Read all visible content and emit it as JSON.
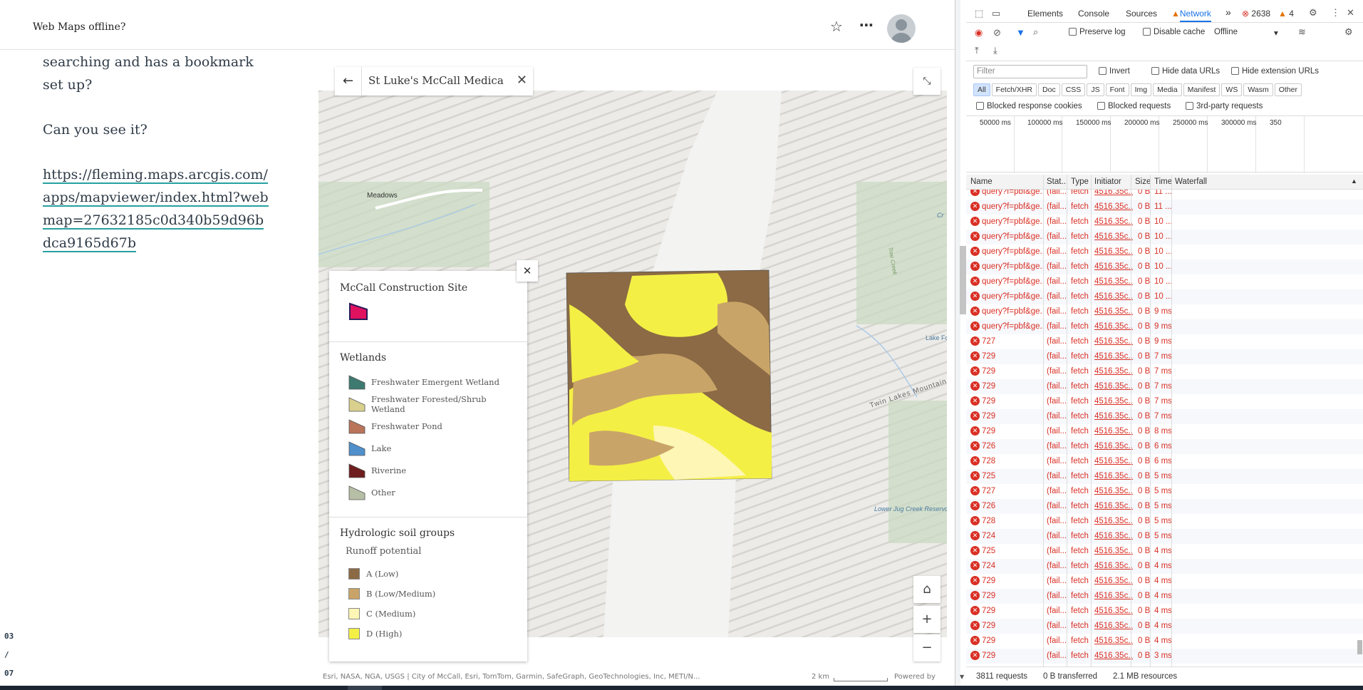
{
  "header": {
    "title": "Web Maps offline?"
  },
  "story": {
    "p1": "This map allows navigation, searching and has a bookmark set up?",
    "p2": "Can you see it?",
    "link": "https://fleming.maps.arcgis.com/apps/mapviewer/index.html?webmap=27632185c0d340b59d96bdca9165d67b"
  },
  "pager": {
    "current": "03",
    "sep": "/",
    "total": "07"
  },
  "map": {
    "search_value": "St Luke's McCall Medical",
    "attribution": "Esri, NASA, NGA, USGS | City of McCall, Esri, TomTom, Garmin, SafeGraph, GeoTechnologies, Inc, METI/N...",
    "scale": "2 km",
    "powered": "Powered by Esri",
    "labels": {
      "meadows": "Meadows",
      "lake_fork": "Lake Fork",
      "twin_lakes": "Twin Lakes Mountain",
      "lower_jug": "Lower Jug Creek Reservoir",
      "tree_creek": "Tree Creek",
      "cr": "Cr"
    }
  },
  "legend": {
    "site_title": "McCall Construction Site",
    "wetlands_title": "Wetlands",
    "wetlands": [
      {
        "label": "Freshwater Emergent Wetland",
        "color": "#3d7a70"
      },
      {
        "label": "Freshwater Forested/Shrub Wetland",
        "color": "#d9d08e"
      },
      {
        "label": "Freshwater Pond",
        "color": "#b9745a"
      },
      {
        "label": "Lake",
        "color": "#4f8fcc"
      },
      {
        "label": "Riverine",
        "color": "#6e1e1e"
      },
      {
        "label": "Other",
        "color": "#b6bea5"
      }
    ],
    "soil_title": "Hydrologic soil groups",
    "soil_sub": "Runoff potential",
    "soils": [
      {
        "label": "A (Low)",
        "color": "#8b6a45"
      },
      {
        "label": "B (Low/Medium)",
        "color": "#c9a468"
      },
      {
        "label": "C (Medium)",
        "color": "#fdf6b4"
      },
      {
        "label": "D (High)",
        "color": "#f4ef45"
      }
    ]
  },
  "devtools": {
    "tabs": [
      "Elements",
      "Console",
      "Sources",
      "Network"
    ],
    "errors": "2638",
    "warnings": "4",
    "preserve_log": "Preserve log",
    "disable_cache": "Disable cache",
    "throttle": "Offline",
    "filter_placeholder": "Filter",
    "invert": "Invert",
    "hide_data": "Hide data URLs",
    "hide_ext": "Hide extension URLs",
    "types": [
      "All",
      "Fetch/XHR",
      "Doc",
      "CSS",
      "JS",
      "Font",
      "Img",
      "Media",
      "Manifest",
      "WS",
      "Wasm",
      "Other"
    ],
    "blocked_cookies": "Blocked response cookies",
    "blocked_requests": "Blocked requests",
    "third_party": "3rd-party requests",
    "timeline": [
      "50000 ms",
      "100000 ms",
      "150000 ms",
      "200000 ms",
      "250000 ms",
      "300000 ms",
      "350"
    ],
    "columns": [
      "Name",
      "Stat...",
      "Type",
      "Initiator",
      "Size",
      "Time",
      "Waterfall"
    ],
    "rows": [
      {
        "name": "query?f=pbf&ge...",
        "status": "(fail...",
        "type": "fetch",
        "initiator": "4516.35c...",
        "size": "0 B",
        "time": "11 ..."
      },
      {
        "name": "query?f=pbf&ge...",
        "status": "(fail...",
        "type": "fetch",
        "initiator": "4516.35c...",
        "size": "0 B",
        "time": "11 ..."
      },
      {
        "name": "query?f=pbf&ge...",
        "status": "(fail...",
        "type": "fetch",
        "initiator": "4516.35c...",
        "size": "0 B",
        "time": "10 ..."
      },
      {
        "name": "query?f=pbf&ge...",
        "status": "(fail...",
        "type": "fetch",
        "initiator": "4516.35c...",
        "size": "0 B",
        "time": "10 ..."
      },
      {
        "name": "query?f=pbf&ge...",
        "status": "(fail...",
        "type": "fetch",
        "initiator": "4516.35c...",
        "size": "0 B",
        "time": "10 ..."
      },
      {
        "name": "query?f=pbf&ge...",
        "status": "(fail...",
        "type": "fetch",
        "initiator": "4516.35c...",
        "size": "0 B",
        "time": "10 ..."
      },
      {
        "name": "query?f=pbf&ge...",
        "status": "(fail...",
        "type": "fetch",
        "initiator": "4516.35c...",
        "size": "0 B",
        "time": "10 ..."
      },
      {
        "name": "query?f=pbf&ge...",
        "status": "(fail...",
        "type": "fetch",
        "initiator": "4516.35c...",
        "size": "0 B",
        "time": "10 ..."
      },
      {
        "name": "query?f=pbf&ge...",
        "status": "(fail...",
        "type": "fetch",
        "initiator": "4516.35c...",
        "size": "0 B",
        "time": "9 ms"
      },
      {
        "name": "query?f=pbf&ge...",
        "status": "(fail...",
        "type": "fetch",
        "initiator": "4516.35c...",
        "size": "0 B",
        "time": "9 ms"
      },
      {
        "name": "727",
        "status": "(fail...",
        "type": "fetch",
        "initiator": "4516.35c...",
        "size": "0 B",
        "time": "9 ms"
      },
      {
        "name": "729",
        "status": "(fail...",
        "type": "fetch",
        "initiator": "4516.35c...",
        "size": "0 B",
        "time": "7 ms"
      },
      {
        "name": "729",
        "status": "(fail...",
        "type": "fetch",
        "initiator": "4516.35c...",
        "size": "0 B",
        "time": "7 ms"
      },
      {
        "name": "729",
        "status": "(fail...",
        "type": "fetch",
        "initiator": "4516.35c...",
        "size": "0 B",
        "time": "7 ms"
      },
      {
        "name": "729",
        "status": "(fail...",
        "type": "fetch",
        "initiator": "4516.35c...",
        "size": "0 B",
        "time": "7 ms"
      },
      {
        "name": "729",
        "status": "(fail...",
        "type": "fetch",
        "initiator": "4516.35c...",
        "size": "0 B",
        "time": "7 ms"
      },
      {
        "name": "729",
        "status": "(fail...",
        "type": "fetch",
        "initiator": "4516.35c...",
        "size": "0 B",
        "time": "8 ms"
      },
      {
        "name": "726",
        "status": "(fail...",
        "type": "fetch",
        "initiator": "4516.35c...",
        "size": "0 B",
        "time": "6 ms"
      },
      {
        "name": "728",
        "status": "(fail...",
        "type": "fetch",
        "initiator": "4516.35c...",
        "size": "0 B",
        "time": "6 ms"
      },
      {
        "name": "725",
        "status": "(fail...",
        "type": "fetch",
        "initiator": "4516.35c...",
        "size": "0 B",
        "time": "5 ms"
      },
      {
        "name": "727",
        "status": "(fail...",
        "type": "fetch",
        "initiator": "4516.35c...",
        "size": "0 B",
        "time": "5 ms"
      },
      {
        "name": "726",
        "status": "(fail...",
        "type": "fetch",
        "initiator": "4516.35c...",
        "size": "0 B",
        "time": "5 ms"
      },
      {
        "name": "728",
        "status": "(fail...",
        "type": "fetch",
        "initiator": "4516.35c...",
        "size": "0 B",
        "time": "5 ms"
      },
      {
        "name": "724",
        "status": "(fail...",
        "type": "fetch",
        "initiator": "4516.35c...",
        "size": "0 B",
        "time": "5 ms"
      },
      {
        "name": "725",
        "status": "(fail...",
        "type": "fetch",
        "initiator": "4516.35c...",
        "size": "0 B",
        "time": "4 ms"
      },
      {
        "name": "724",
        "status": "(fail...",
        "type": "fetch",
        "initiator": "4516.35c...",
        "size": "0 B",
        "time": "4 ms"
      },
      {
        "name": "729",
        "status": "(fail...",
        "type": "fetch",
        "initiator": "4516.35c...",
        "size": "0 B",
        "time": "4 ms"
      },
      {
        "name": "729",
        "status": "(fail...",
        "type": "fetch",
        "initiator": "4516.35c...",
        "size": "0 B",
        "time": "4 ms"
      },
      {
        "name": "729",
        "status": "(fail...",
        "type": "fetch",
        "initiator": "4516.35c...",
        "size": "0 B",
        "time": "4 ms"
      },
      {
        "name": "729",
        "status": "(fail...",
        "type": "fetch",
        "initiator": "4516.35c...",
        "size": "0 B",
        "time": "4 ms"
      },
      {
        "name": "729",
        "status": "(fail...",
        "type": "fetch",
        "initiator": "4516.35c...",
        "size": "0 B",
        "time": "4 ms"
      },
      {
        "name": "729",
        "status": "(fail...",
        "type": "fetch",
        "initiator": "4516.35c...",
        "size": "0 B",
        "time": "3 ms"
      }
    ],
    "status": {
      "requests": "3811 requests",
      "transferred": "0 B transferred",
      "resources": "2.1 MB resources"
    }
  }
}
